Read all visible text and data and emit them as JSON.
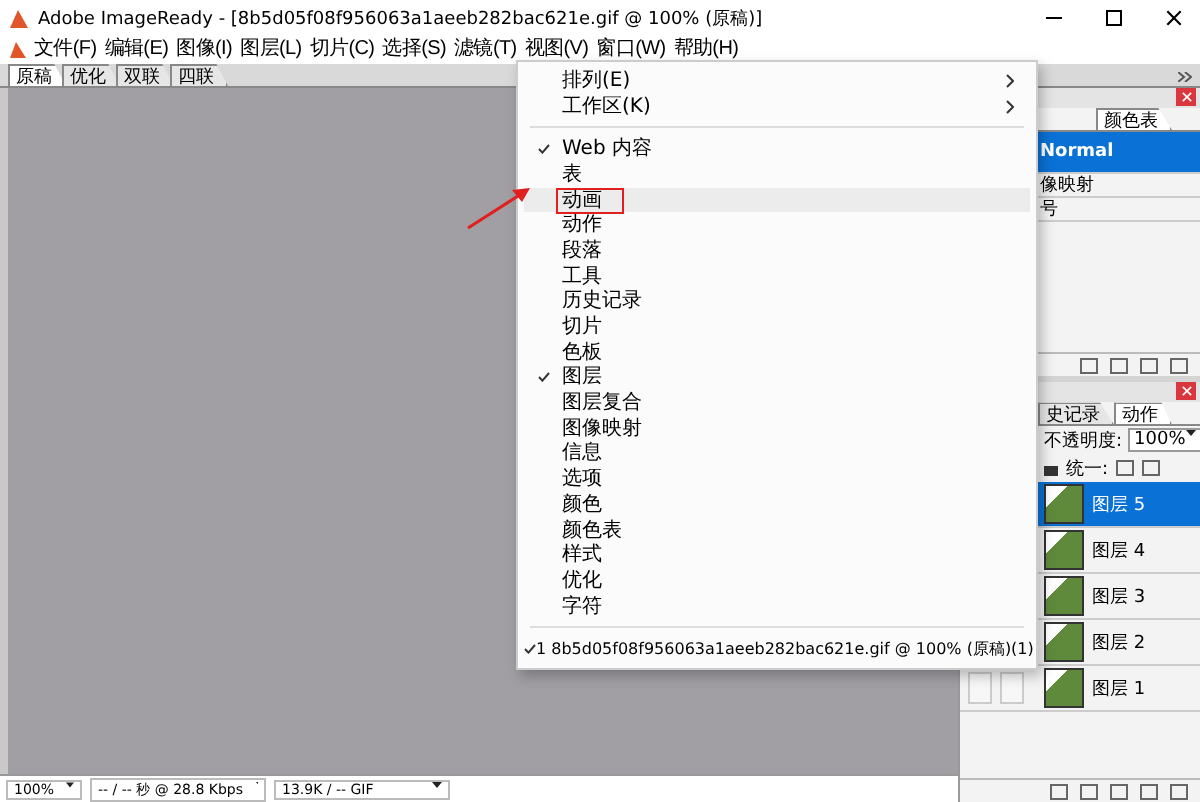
{
  "window": {
    "title": "Adobe ImageReady - [8b5d05f08f956063a1aeeb282bac621e.gif @ 100% (原稿)]"
  },
  "menubar": [
    "文件(F)",
    "编辑(E)",
    "图像(I)",
    "图层(L)",
    "切片(C)",
    "选择(S)",
    "滤镜(T)",
    "视图(V)",
    "窗口(W)",
    "帮助(H)"
  ],
  "doc_tabs": [
    {
      "label": "原稿",
      "selected": true
    },
    {
      "label": "优化",
      "selected": false
    },
    {
      "label": "双联",
      "selected": false
    },
    {
      "label": "四联",
      "selected": false
    }
  ],
  "window_menu": [
    {
      "kind": "item",
      "label": "排列(E)",
      "checked": false,
      "submenu": true,
      "highlighted": false
    },
    {
      "kind": "item",
      "label": "工作区(K)",
      "checked": false,
      "submenu": true,
      "highlighted": false
    },
    {
      "kind": "separator"
    },
    {
      "kind": "item",
      "label": "Web 内容",
      "checked": true,
      "submenu": false,
      "highlighted": false
    },
    {
      "kind": "item",
      "label": "表",
      "checked": false,
      "submenu": false,
      "highlighted": false
    },
    {
      "kind": "item",
      "label": "动画",
      "checked": false,
      "submenu": false,
      "highlighted": true
    },
    {
      "kind": "item",
      "label": "动作",
      "checked": false,
      "submenu": false,
      "highlighted": false
    },
    {
      "kind": "item",
      "label": "段落",
      "checked": false,
      "submenu": false,
      "highlighted": false
    },
    {
      "kind": "item",
      "label": "工具",
      "checked": false,
      "submenu": false,
      "highlighted": false
    },
    {
      "kind": "item",
      "label": "历史记录",
      "checked": false,
      "submenu": false,
      "highlighted": false
    },
    {
      "kind": "item",
      "label": "切片",
      "checked": false,
      "submenu": false,
      "highlighted": false
    },
    {
      "kind": "item",
      "label": "色板",
      "checked": false,
      "submenu": false,
      "highlighted": false
    },
    {
      "kind": "item",
      "label": "图层",
      "checked": true,
      "submenu": false,
      "highlighted": false
    },
    {
      "kind": "item",
      "label": "图层复合",
      "checked": false,
      "submenu": false,
      "highlighted": false
    },
    {
      "kind": "item",
      "label": "图像映射",
      "checked": false,
      "submenu": false,
      "highlighted": false
    },
    {
      "kind": "item",
      "label": "信息",
      "checked": false,
      "submenu": false,
      "highlighted": false
    },
    {
      "kind": "item",
      "label": "选项",
      "checked": false,
      "submenu": false,
      "highlighted": false
    },
    {
      "kind": "item",
      "label": "颜色",
      "checked": false,
      "submenu": false,
      "highlighted": false
    },
    {
      "kind": "item",
      "label": "颜色表",
      "checked": false,
      "submenu": false,
      "highlighted": false
    },
    {
      "kind": "item",
      "label": "样式",
      "checked": false,
      "submenu": false,
      "highlighted": false
    },
    {
      "kind": "item",
      "label": "优化",
      "checked": false,
      "submenu": false,
      "highlighted": false
    },
    {
      "kind": "item",
      "label": "字符",
      "checked": false,
      "submenu": false,
      "highlighted": false
    },
    {
      "kind": "separator"
    },
    {
      "kind": "item",
      "label": "1 8b5d05f08f956063a1aeeb282bac621e.gif @ 100% (原稿)(1)",
      "checked": true,
      "submenu": false,
      "highlighted": false
    }
  ],
  "annotation": {
    "arrow": true
  },
  "style_panel": {
    "tab": "颜色表",
    "rows": [
      {
        "label": "Normal",
        "selected": true
      },
      {
        "label": "像映射",
        "selected": false
      },
      {
        "label": "号",
        "selected": false
      }
    ]
  },
  "layers_panel": {
    "tabs": [
      {
        "label": "史记录",
        "selected": false
      },
      {
        "label": "动作",
        "selected": true
      }
    ],
    "opacity_label": "不透明度:",
    "opacity": "100%",
    "unify_label": "统一:",
    "layers": [
      {
        "name": "图层 5",
        "selected": true
      },
      {
        "name": "图层 4",
        "selected": false
      },
      {
        "name": "图层 3",
        "selected": false
      },
      {
        "name": "图层 2",
        "selected": false
      },
      {
        "name": "图层 1",
        "selected": false
      }
    ]
  },
  "status_bar": {
    "zoom": "100%",
    "speed": "-- / -- 秒 @ 28.8 Kbps",
    "size": "13.9K / -- GIF"
  }
}
